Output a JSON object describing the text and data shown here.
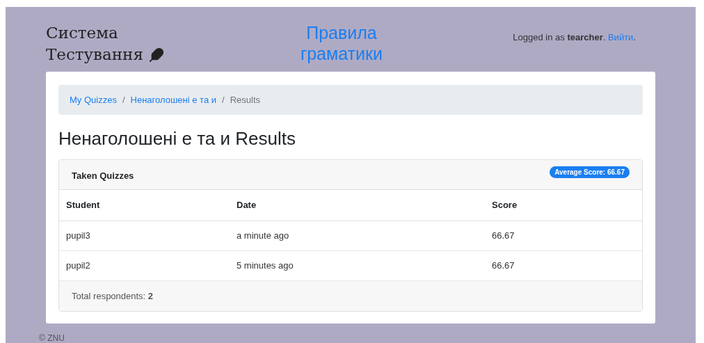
{
  "header": {
    "brand_lines": [
      "Система",
      "Тестування"
    ],
    "center_link_lines": [
      "Правила",
      "граматики"
    ],
    "login": {
      "before": "Logged in as **tearcher**. ",
      "link": "Вийти",
      "after": "."
    }
  },
  "breadcrumb": {
    "separator": "/",
    "items": [
      {
        "label": "My Quizzes",
        "kind": "link"
      },
      {
        "label": "Ненаголошені е та и",
        "kind": "link"
      },
      {
        "label": "Results",
        "kind": "current"
      }
    ]
  },
  "title": "Ненаголошені е та и Results",
  "panel": {
    "title": "Taken Quizzes",
    "badge": "Average Score: 66.67",
    "columns": [
      "Student",
      "Date",
      "Score"
    ],
    "rows": [
      [
        "pupil3",
        "a minute ago",
        "66.67"
      ],
      [
        "pupil2",
        "5 minutes ago",
        "66.67"
      ]
    ],
    "footer": "Total respondents: **2**"
  },
  "footer": "© ZNU"
}
